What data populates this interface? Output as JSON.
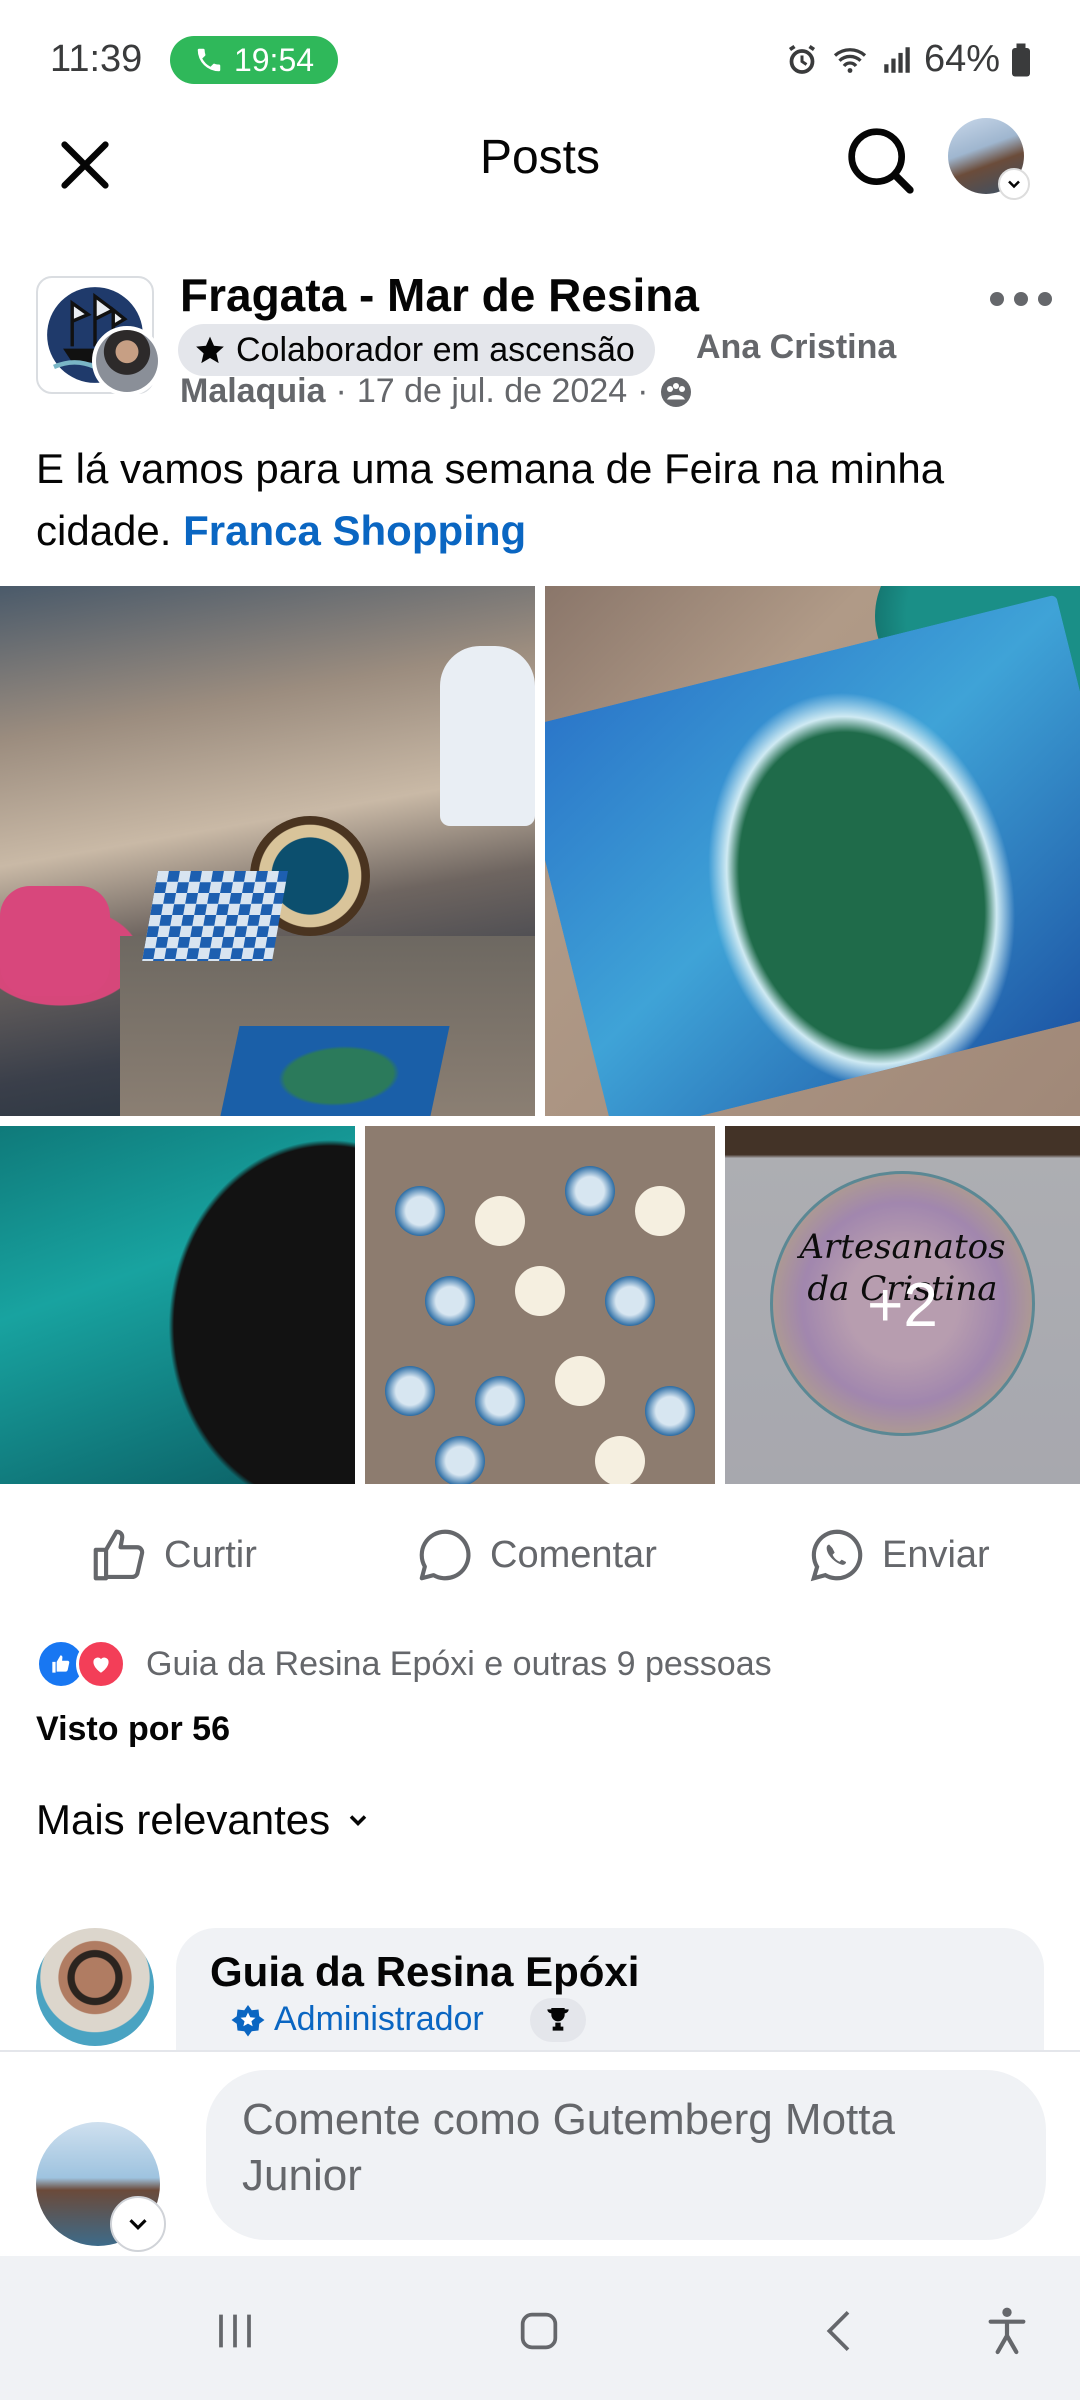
{
  "status_bar": {
    "time": "11:39",
    "call_duration": "19:54",
    "battery": "64%"
  },
  "appbar": {
    "title": "Posts"
  },
  "post": {
    "page_name": "Fragata - Mar de Resina",
    "badge": "Colaborador em ascensão",
    "author_first": "Ana Cristina",
    "author_last": "Malaquia",
    "date": "17 de jul. de 2024",
    "text": "E lá vamos para uma semana de Feira na minha cidade.",
    "link": "Franca Shopping",
    "extra_photos": "+2",
    "photo5_text": "Artesanatos da Cristina"
  },
  "actions": {
    "like": "Curtir",
    "comment": "Comentar",
    "send": "Enviar"
  },
  "reactions": {
    "summary": "Guia da Resina Epóxi e outras 9 pessoas",
    "seen_by": "Visto por 56"
  },
  "comments": {
    "sort_label": "Mais relevantes",
    "items": [
      {
        "name": "Guia da Resina Epóxi",
        "role": "Administrador"
      }
    ]
  },
  "composer": {
    "placeholder": "Comente como Gutemberg Motta Junior"
  },
  "colors": {
    "link": "#0a66c2",
    "like_blue": "#1877f2",
    "love_red": "#f33e58",
    "call_green": "#2fb85a",
    "secondary_text": "#65676b"
  }
}
